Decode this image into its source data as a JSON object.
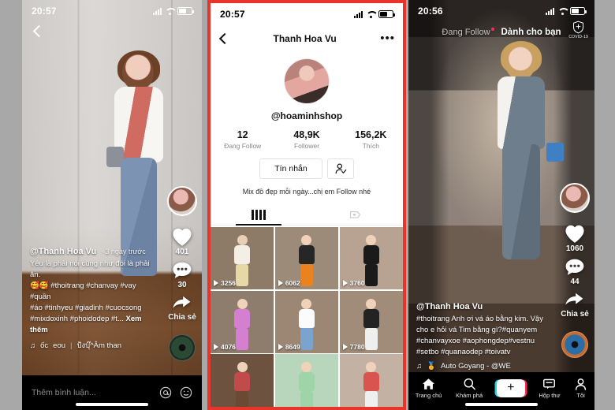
{
  "left_phone": {
    "status": {
      "time": "20:57",
      "signal_icon": "signal-bars-icon",
      "wifi_icon": "wifi-icon",
      "battery_icon": "battery-icon"
    },
    "back_icon": "back-chevron-icon",
    "rail": {
      "avatar_name": "creator-avatar",
      "like": {
        "icon": "heart-icon",
        "count": "401"
      },
      "comment": {
        "icon": "comment-bubble-icon",
        "count": "30"
      },
      "share": {
        "icon": "share-arrow-icon",
        "label": "Chia sẻ"
      },
      "disc_icon": "music-disc-icon"
    },
    "caption": {
      "username": "@Thanh Hoa Vu",
      "time": "3 ngày trước",
      "line1": "Yêu là phải nói cũng như đói là phải ăn.",
      "line2": "🥰🥰 #thoitrang #chanvay #vay #quần",
      "line3": "#áo #tinhyeu #giadinh #cuocsong",
      "line4": "#mixdoxinh #phoidodep #t...",
      "more": "Xem thêm"
    },
    "music": {
      "note_icon": "music-note-icon",
      "text_a": "ốc",
      "text_b": "eou",
      "text_c": "ป้งบุ๊^Âm than"
    },
    "comment_bar": {
      "placeholder": "Thêm bình luận...",
      "mention_icon": "at-mention-icon",
      "emoji_icon": "emoji-smiley-icon"
    }
  },
  "mid_phone": {
    "status": {
      "time": "20:57",
      "signal_icon": "signal-bars-icon",
      "wifi_icon": "wifi-icon",
      "battery_icon": "battery-icon"
    },
    "nav": {
      "back_icon": "back-chevron-icon",
      "title": "Thanh Hoa Vu",
      "more_icon": "more-dots-icon"
    },
    "avatar_name": "profile-avatar",
    "handle": "@hoaminhshop",
    "stats": [
      {
        "num": "12",
        "label": "Đang Follow"
      },
      {
        "num": "48,9K",
        "label": "Follower"
      },
      {
        "num": "156,2K",
        "label": "Thích"
      }
    ],
    "actions": {
      "message_label": "Tín nhắn",
      "add_user_icon": "add-user-icon"
    },
    "bio": "Mix đồ đẹp mỗi ngày...chị em Follow nhé",
    "tabs": [
      {
        "icon": "grid-posts-icon",
        "active": true
      },
      {
        "icon": "liked-heart-tag-icon",
        "active": false
      }
    ],
    "grid": [
      {
        "views": "3256",
        "skin": "#e8cfb6",
        "top": "#f3efe6",
        "bottom": "#e4d9a7",
        "bg": "#8d7a67"
      },
      {
        "views": "6062",
        "skin": "#f0d2ba",
        "top": "#262626",
        "bottom": "#e9821f",
        "bg": "#9d8b79"
      },
      {
        "views": "3760",
        "skin": "#f0d2ba",
        "top": "#1a1a1a",
        "bottom": "#1a1a1a",
        "bg": "#b8a393"
      },
      {
        "views": "4076",
        "skin": "#f0d2ba",
        "top": "#d47fd0",
        "bottom": "#d47fd0",
        "bg": "#8e7c6d"
      },
      {
        "views": "8649",
        "skin": "#f0d2ba",
        "top": "#fbfbfb",
        "bottom": "#7ba3cf",
        "bg": "#9c8674"
      },
      {
        "views": "7780",
        "skin": "#f0d2ba",
        "top": "#232323",
        "bottom": "#efefef",
        "bg": "#a08c79"
      },
      {
        "views": "",
        "skin": "#f0d2ba",
        "top": "#c14a4a",
        "bottom": "#6a4a33",
        "bg": "#6d5240"
      },
      {
        "views": "",
        "skin": "#f0d2ba",
        "top": "#9fd3a8",
        "bottom": "#9fd3a8",
        "bg": "#b8d6bc"
      },
      {
        "views": "",
        "skin": "#f0d2ba",
        "top": "#d9534f",
        "bottom": "#efefef",
        "bg": "#c3b2a3"
      }
    ]
  },
  "right_phone": {
    "status": {
      "time": "20:56",
      "signal_icon": "signal-bars-icon",
      "wifi_icon": "wifi-icon",
      "battery_icon": "battery-icon"
    },
    "tabs": [
      {
        "label": "Đang Follow",
        "active": false,
        "dot": true
      },
      {
        "label": "Dành cho bạn",
        "active": true,
        "dot": false
      }
    ],
    "covid": {
      "icon": "shield-icon",
      "label": "COVID-19"
    },
    "rail": {
      "avatar_name": "creator-avatar",
      "like": {
        "icon": "heart-icon",
        "count": "1060"
      },
      "comment": {
        "icon": "comment-bubble-icon",
        "count": "44"
      },
      "share": {
        "icon": "share-arrow-icon",
        "label": "Chia sẻ"
      },
      "disc_icon": "music-disc-icon"
    },
    "caption": {
      "username": "@Thanh Hoa Vu",
      "line1": "#thoitrang Anh ơi vá áo bằng kim. Vậy",
      "line2": "cho e hỏi vá Tim bằng gì?#quanyem",
      "line3": "#chanvayxoe #aophongdep#vestnu",
      "line4": "#setbo #quanaodep #toivatv"
    },
    "music": {
      "note_icon": "music-note-icon",
      "badge_icon": "medal-icon",
      "text": "Auto Goyang - @WE"
    },
    "bottom_nav": [
      {
        "icon": "home-icon",
        "label": "Trang chủ"
      },
      {
        "icon": "search-icon",
        "label": "Khám phá"
      },
      {
        "icon": "plus-icon",
        "label": ""
      },
      {
        "icon": "inbox-icon",
        "label": "Hộp thư"
      },
      {
        "icon": "profile-icon",
        "label": "Tôi"
      }
    ]
  }
}
